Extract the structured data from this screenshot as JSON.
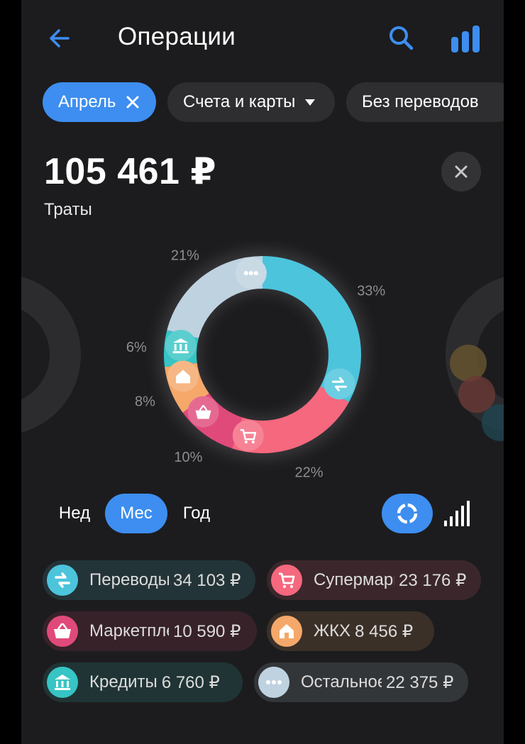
{
  "header": {
    "title": "Операции",
    "back_icon": "arrow-left-icon",
    "search_icon": "search-icon",
    "stats_icon": "bar-chart-icon"
  },
  "filters": [
    {
      "label": "Апрель",
      "active": true,
      "icon": "close-icon"
    },
    {
      "label": "Счета и карты",
      "active": false,
      "icon": "dropdown-icon"
    },
    {
      "label": "Без переводов",
      "active": false
    }
  ],
  "summary": {
    "amount": "105 461 ₽",
    "label": "Траты"
  },
  "chart_data": {
    "type": "pie",
    "style": "donut",
    "categories": [
      "Переводы",
      "Супермаркеты",
      "Маркетплейсы",
      "ЖКХ",
      "Кредиты",
      "Остальное"
    ],
    "labels": [
      "33%",
      "22%",
      "10%",
      "8%",
      "6%",
      "21%"
    ],
    "values": [
      33,
      22,
      10,
      8,
      6,
      21
    ],
    "colors": [
      "#4cc4dc",
      "#f5687e",
      "#e04a7a",
      "#f5a86a",
      "#36c4c4",
      "#bfd2e0"
    ]
  },
  "period": {
    "week": "Нед",
    "month": "Мес",
    "year": "Год",
    "selected": "month"
  },
  "view_toggle": {
    "donut_icon": "donut-chart-icon",
    "bars_icon": "signal-bars-icon",
    "selected": "donut"
  },
  "categories": [
    {
      "name": "Переводы",
      "sum": "34 103 ₽",
      "color": "#4cc4dc",
      "icon": "transfer-icon"
    },
    {
      "name": "Супермаркеты",
      "sum": "23 176 ₽",
      "color": "#f5687e",
      "icon": "cart-icon"
    },
    {
      "name": "Маркетплейсы",
      "sum": "10 590 ₽",
      "color": "#e04a7a",
      "icon": "basket-icon"
    },
    {
      "name": "ЖКХ",
      "sum": "8 456 ₽",
      "color": "#f5a86a",
      "icon": "house-icon"
    },
    {
      "name": "Кредиты",
      "sum": "6 760 ₽",
      "color": "#36c4c4",
      "icon": "bank-icon"
    },
    {
      "name": "Остальное",
      "sum": "22 375 ₽",
      "color": "#bfd2e0",
      "icon": "dots-icon"
    }
  ]
}
